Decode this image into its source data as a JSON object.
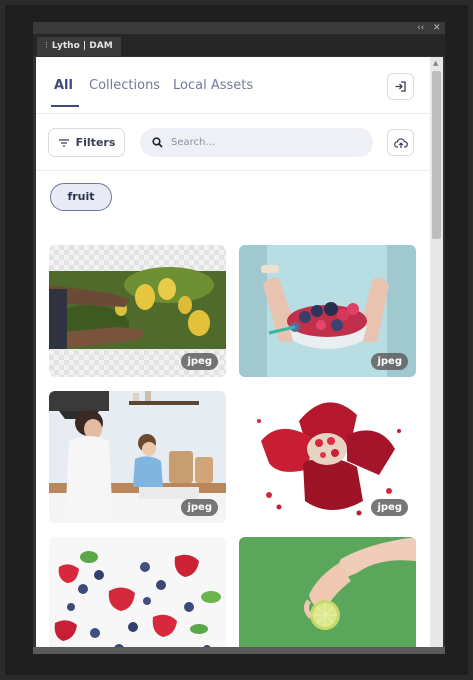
{
  "window": {
    "collapse_label": "‹‹",
    "close_label": "✕",
    "tab_label": "Lytho | DAM",
    "tab_grip": "⁝"
  },
  "nav": {
    "tabs": [
      {
        "label": "All",
        "active": true
      },
      {
        "label": "Collections",
        "active": false
      },
      {
        "label": "Local Assets",
        "active": false
      }
    ],
    "login_icon": "login-arrow-icon"
  },
  "toolbar": {
    "filters_label": "Filters",
    "filters_icon": "filter-lines-icon",
    "search_placeholder": "Search...",
    "search_icon": "magnifier-icon",
    "upload_icon": "cloud-upload-icon"
  },
  "active_tags": [
    {
      "label": "fruit"
    }
  ],
  "assets": [
    {
      "subject": "hands picking lemons from a tree",
      "format": "jpeg"
    },
    {
      "subject": "hands holding a bowl of berries",
      "format": "jpeg"
    },
    {
      "subject": "woman and child in a kitchen",
      "format": "jpeg"
    },
    {
      "subject": "split pomegranate",
      "format": "jpeg"
    },
    {
      "subject": "strawberries and blueberries on white",
      "format": ""
    },
    {
      "subject": "hand holding a lime slice on green",
      "format": ""
    }
  ],
  "colors": {
    "accent": "#3e4a7a",
    "tab_inactive": "#6f7a96",
    "search_bg": "#eef0f5",
    "tag_border": "#6c7a9e",
    "badge_bg": "#5f5f5f"
  }
}
